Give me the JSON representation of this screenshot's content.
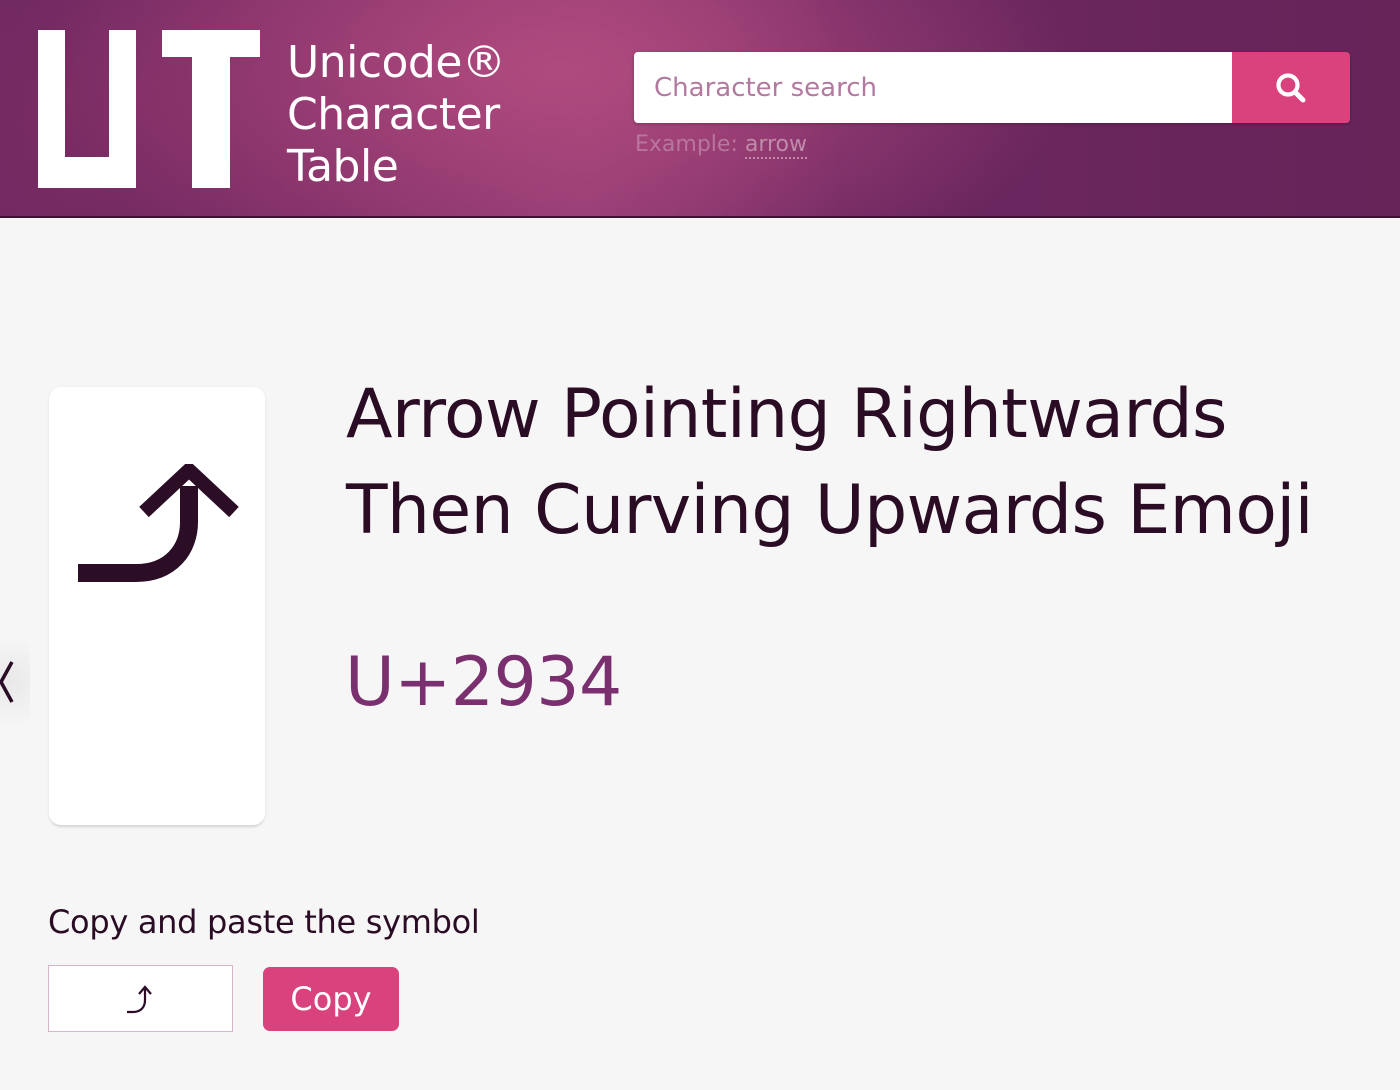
{
  "colors": {
    "header_gradient": [
      "#6a2660",
      "#8e3a73",
      "#b04a7e",
      "#662459"
    ],
    "accent": "#d9427d",
    "title_text": "#2a0c24",
    "codepoint_text": "#7a2f6e",
    "page_background": "#f6f6f6"
  },
  "header": {
    "logo_icon": "ut-logo-mark",
    "site_name_lines": [
      "Unicode®",
      "Character",
      "Table"
    ],
    "search": {
      "placeholder": "Character search",
      "value": "",
      "button_icon": "search-icon",
      "example_prefix": "Example: ",
      "example_link": "arrow"
    }
  },
  "character": {
    "title": "Arrow Pointing Rightwards Then Curving Upwards Emoji",
    "codepoint": "U+2934",
    "glyph_icon": "arrow-right-curving-up-icon",
    "prev_icon": "chevron-left-icon"
  },
  "copy_section": {
    "label": "Copy and paste the symbol",
    "field_value": "⤴",
    "button_label": "Copy"
  }
}
